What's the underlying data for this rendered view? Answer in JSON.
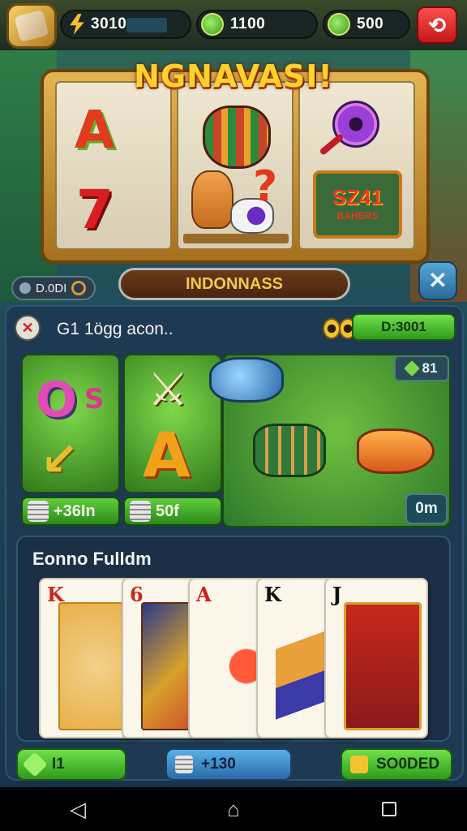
{
  "topbar": {
    "resources": [
      {
        "label": "3010"
      },
      {
        "label": "1100"
      },
      {
        "label": "500"
      }
    ]
  },
  "slot": {
    "title": "NGNAVASI!",
    "sign_big": "SZ41",
    "sign_small": "BAHERS"
  },
  "subbar": {
    "left_pill": "D.0DI",
    "banner": "INDONNASS"
  },
  "info": {
    "text": "G1 1ögg acon..",
    "coins": "00",
    "button": "D:3001"
  },
  "tiles": [
    {
      "label": "+36In"
    },
    {
      "label": "50f"
    }
  ],
  "field": {
    "badge": "81",
    "om": "0m"
  },
  "cards_panel": {
    "title": "Eonno Fulldm",
    "cards": [
      {
        "rank": "K"
      },
      {
        "rank": "6"
      },
      {
        "rank": "A"
      },
      {
        "rank": "K"
      },
      {
        "rank": "J"
      }
    ]
  },
  "bottom": {
    "btn1": "I1",
    "btn2": "+130",
    "btn3": "SO0DED"
  },
  "colors": {
    "green_button": "#3fb52a",
    "blue_button": "#3a86c8",
    "close_red": "#e22a2a",
    "title_gold": "#ffd12a"
  }
}
